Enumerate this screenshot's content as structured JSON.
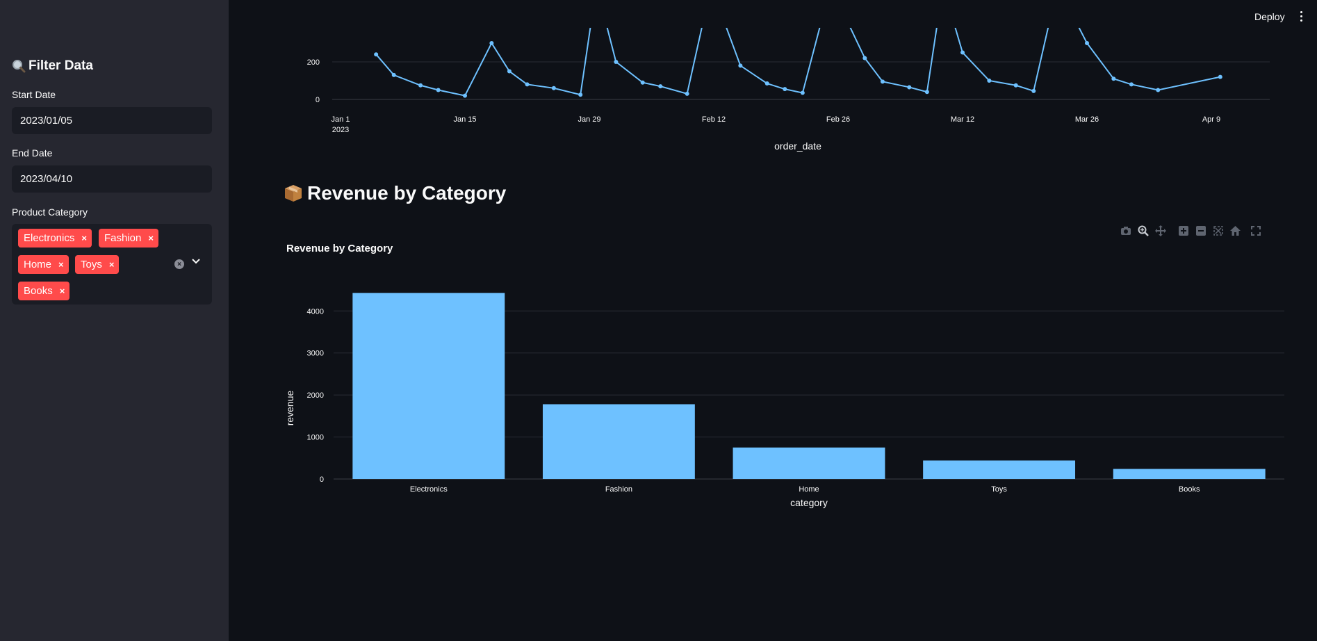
{
  "sidebar": {
    "title": "Filter Data",
    "title_icon": "magnifier-icon",
    "start_date_label": "Start Date",
    "start_date_value": "2023/01/05",
    "end_date_label": "End Date",
    "end_date_value": "2023/04/10",
    "category_label": "Product Category",
    "selected_categories": [
      "Electronics",
      "Fashion",
      "Home",
      "Toys",
      "Books"
    ],
    "tag_remove_glyph": "×",
    "clear_glyph": "×"
  },
  "header": {
    "deploy_label": "Deploy"
  },
  "section": {
    "heading": "Revenue by Category",
    "heading_icon": "package-icon"
  },
  "colors": {
    "accent": "#ff4b4b",
    "series": "#6ec1ff",
    "background": "#0e1117",
    "sidebar": "#262730"
  },
  "modebar": {
    "icons": [
      "camera-icon",
      "zoom-icon",
      "pan-icon",
      "zoom-in-icon",
      "zoom-out-icon",
      "autoscale-icon",
      "home-icon",
      "fullscreen-icon"
    ]
  },
  "chart_data": [
    {
      "type": "line",
      "title": "",
      "xlabel": "order_date",
      "ylabel": "",
      "x_tick_labels": [
        "Jan 1",
        "Jan 15",
        "Jan 29",
        "Feb 12",
        "Feb 26",
        "Mar 12",
        "Mar 26",
        "Apr 9"
      ],
      "x_tick_sublabel": "2023",
      "y_tick_labels": [
        "0",
        "200"
      ],
      "note": "partial view, upper portion scrolled out of view",
      "points": [
        {
          "x": "2023-01-05",
          "y": 240
        },
        {
          "x": "2023-01-07",
          "y": 130
        },
        {
          "x": "2023-01-10",
          "y": 75
        },
        {
          "x": "2023-01-12",
          "y": 50
        },
        {
          "x": "2023-01-15",
          "y": 20
        },
        {
          "x": "2023-01-18",
          "y": 300
        },
        {
          "x": "2023-01-20",
          "y": 150
        },
        {
          "x": "2023-01-22",
          "y": 80
        },
        {
          "x": "2023-01-25",
          "y": 60
        },
        {
          "x": "2023-01-28",
          "y": 25
        },
        {
          "x": "2023-02-01",
          "y": 200
        },
        {
          "x": "2023-02-04",
          "y": 90
        },
        {
          "x": "2023-02-06",
          "y": 70
        },
        {
          "x": "2023-02-09",
          "y": 30
        },
        {
          "x": "2023-02-15",
          "y": 180
        },
        {
          "x": "2023-02-18",
          "y": 85
        },
        {
          "x": "2023-02-20",
          "y": 55
        },
        {
          "x": "2023-02-22",
          "y": 35
        },
        {
          "x": "2023-03-01",
          "y": 220
        },
        {
          "x": "2023-03-03",
          "y": 95
        },
        {
          "x": "2023-03-06",
          "y": 65
        },
        {
          "x": "2023-03-08",
          "y": 40
        },
        {
          "x": "2023-03-12",
          "y": 250
        },
        {
          "x": "2023-03-15",
          "y": 100
        },
        {
          "x": "2023-03-18",
          "y": 75
        },
        {
          "x": "2023-03-20",
          "y": 45
        },
        {
          "x": "2023-03-26",
          "y": 300
        },
        {
          "x": "2023-03-29",
          "y": 110
        },
        {
          "x": "2023-03-31",
          "y": 80
        },
        {
          "x": "2023-04-03",
          "y": 50
        },
        {
          "x": "2023-04-10",
          "y": 120
        }
      ],
      "visible_y_max": 350
    },
    {
      "type": "bar",
      "title": "Revenue by Category",
      "xlabel": "category",
      "ylabel": "revenue",
      "categories": [
        "Electronics",
        "Fashion",
        "Home",
        "Toys",
        "Books"
      ],
      "values": [
        4430,
        1780,
        750,
        440,
        240
      ],
      "ylim": [
        0,
        4700
      ],
      "y_ticks": [
        0,
        1000,
        2000,
        3000,
        4000
      ],
      "grid": true
    }
  ]
}
